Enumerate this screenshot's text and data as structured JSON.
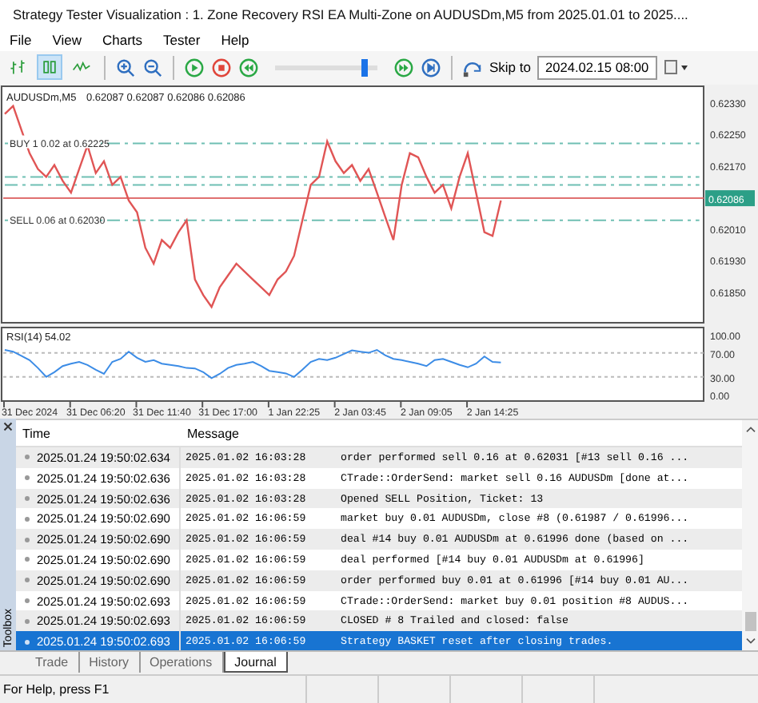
{
  "window": {
    "title": "Strategy Tester Visualization : 1. Zone Recovery RSI EA Multi-Zone on AUDUSDm,M5 from 2025.01.01 to 2025...."
  },
  "menu": [
    "File",
    "View",
    "Charts",
    "Tester",
    "Help"
  ],
  "toolbar": {
    "chart_modes": [
      {
        "kind": "bars",
        "selected": false
      },
      {
        "kind": "candles",
        "selected": true
      },
      {
        "kind": "line",
        "selected": false
      }
    ],
    "speed": {
      "level": 0.88
    },
    "skip_to_label": "Skip to",
    "skip_to_value": "2024.02.15 08:00"
  },
  "price_chart": {
    "quotes": "0.62087 0.62087 0.62086 0.62086",
    "chart_data": {
      "type": "line",
      "series": [
        {
          "name": "AUDUSDm,M5",
          "color": "#e05555",
          "values": [
            0.623,
            0.6232,
            0.6226,
            0.622,
            0.6216,
            0.6214,
            0.6217,
            0.6213,
            0.621,
            0.6216,
            0.6222,
            0.6215,
            0.6218,
            0.6212,
            0.6214,
            0.6208,
            0.6205,
            0.6196,
            0.6192,
            0.6198,
            0.6196,
            0.62,
            0.6203,
            0.6188,
            0.6184,
            0.6181,
            0.6186,
            0.6189,
            0.6192,
            0.619,
            0.6188,
            0.6186,
            0.6184,
            0.6188,
            0.619,
            0.6194,
            0.6203,
            0.6212,
            0.6214,
            0.6223,
            0.6218,
            0.6215,
            0.6217,
            0.6213,
            0.6216,
            0.621,
            0.6204,
            0.6198,
            0.6212,
            0.622,
            0.6219,
            0.6214,
            0.621,
            0.6212,
            0.6206,
            0.6214,
            0.622,
            0.621,
            0.62,
            0.6199,
            0.6208,
            null,
            null,
            null,
            null,
            null,
            null,
            null,
            null,
            null,
            null,
            null,
            null,
            null,
            null,
            null,
            null,
            null,
            null,
            null,
            null,
            null,
            null,
            null,
            null
          ]
        },
        {
          "name": "BUY 1 0.02 at 0.62225",
          "color": "#6fbfb3",
          "line_style": "dashdot",
          "values": [
            0.62225,
            0.62225,
            0.62225,
            0.62225,
            0.62225,
            0.62225,
            0.62225,
            0.62225,
            0.62225,
            0.62225,
            0.62225,
            0.62225,
            0.62225,
            0.62225,
            0.62225,
            0.62225,
            0.62225,
            0.62225,
            0.62225,
            0.62225,
            0.62225,
            0.62225,
            0.62225,
            0.62225,
            0.62225,
            0.62225,
            0.62225,
            0.62225,
            0.62225,
            0.62225,
            0.62225,
            0.62225,
            0.62225,
            0.62225,
            0.62225,
            0.62225,
            0.62225,
            0.62225,
            0.62225,
            0.62225,
            0.62225,
            0.62225,
            0.62225,
            0.62225,
            0.62225,
            0.62225,
            0.62225,
            0.62225,
            0.62225,
            0.62225,
            0.62225,
            0.62225,
            0.62225,
            0.62225,
            0.62225,
            0.62225,
            0.62225,
            0.62225,
            0.62225,
            0.62225,
            0.62225,
            0.62225,
            0.62225,
            0.62225,
            0.62225,
            0.62225,
            0.62225,
            0.62225,
            0.62225,
            0.62225,
            0.62225,
            0.62225,
            0.62225,
            0.62225,
            0.62225,
            0.62225,
            0.62225,
            0.62225,
            0.62225,
            0.62225,
            0.62225,
            0.62225,
            0.62225,
            0.62225,
            0.62225
          ]
        },
        {
          "color": "#6fbfb3",
          "line_style": "dashdot",
          "values": [
            0.6214,
            0.6214,
            0.6214,
            0.6214,
            0.6214,
            0.6214,
            0.6214,
            0.6214,
            0.6214,
            0.6214,
            0.6214,
            0.6214,
            0.6214,
            0.6214,
            0.6214,
            0.6214,
            0.6214,
            0.6214,
            0.6214,
            0.6214,
            0.6214,
            0.6214,
            0.6214,
            0.6214,
            0.6214,
            0.6214,
            0.6214,
            0.6214,
            0.6214,
            0.6214,
            0.6214,
            0.6214,
            0.6214,
            0.6214,
            0.6214,
            0.6214,
            0.6214,
            0.6214,
            0.6214,
            0.6214,
            0.6214,
            0.6214,
            0.6214,
            0.6214,
            0.6214,
            0.6214,
            0.6214,
            0.6214,
            0.6214,
            0.6214,
            0.6214,
            0.6214,
            0.6214,
            0.6214,
            0.6214,
            0.6214,
            0.6214,
            0.6214,
            0.6214,
            0.6214,
            0.6214,
            0.6214,
            0.6214,
            0.6214,
            0.6214,
            0.6214,
            0.6214,
            0.6214,
            0.6214,
            0.6214,
            0.6214,
            0.6214,
            0.6214,
            0.6214,
            0.6214,
            0.6214,
            0.6214,
            0.6214,
            0.6214,
            0.6214,
            0.6214,
            0.6214,
            0.6214,
            0.6214,
            0.6214
          ]
        },
        {
          "color": "#6fbfb3",
          "line_style": "dashdot",
          "values": [
            0.6212,
            0.6212,
            0.6212,
            0.6212,
            0.6212,
            0.6212,
            0.6212,
            0.6212,
            0.6212,
            0.6212,
            0.6212,
            0.6212,
            0.6212,
            0.6212,
            0.6212,
            0.6212,
            0.6212,
            0.6212,
            0.6212,
            0.6212,
            0.6212,
            0.6212,
            0.6212,
            0.6212,
            0.6212,
            0.6212,
            0.6212,
            0.6212,
            0.6212,
            0.6212,
            0.6212,
            0.6212,
            0.6212,
            0.6212,
            0.6212,
            0.6212,
            0.6212,
            0.6212,
            0.6212,
            0.6212,
            0.6212,
            0.6212,
            0.6212,
            0.6212,
            0.6212,
            0.6212,
            0.6212,
            0.6212,
            0.6212,
            0.6212,
            0.6212,
            0.6212,
            0.6212,
            0.6212,
            0.6212,
            0.6212,
            0.6212,
            0.6212,
            0.6212,
            0.6212,
            0.6212,
            0.6212,
            0.6212,
            0.6212,
            0.6212,
            0.6212,
            0.6212,
            0.6212,
            0.6212,
            0.6212,
            0.6212,
            0.6212,
            0.6212,
            0.6212,
            0.6212,
            0.6212,
            0.6212,
            0.6212,
            0.6212,
            0.6212,
            0.6212,
            0.6212,
            0.6212,
            0.6212,
            0.6212
          ]
        },
        {
          "name": "SELL 0.06 at 0.62030",
          "color": "#6fbfb3",
          "line_style": "dashdot",
          "values": [
            0.6203,
            0.6203,
            0.6203,
            0.6203,
            0.6203,
            0.6203,
            0.6203,
            0.6203,
            0.6203,
            0.6203,
            0.6203,
            0.6203,
            0.6203,
            0.6203,
            0.6203,
            0.6203,
            0.6203,
            0.6203,
            0.6203,
            0.6203,
            0.6203,
            0.6203,
            0.6203,
            0.6203,
            0.6203,
            0.6203,
            0.6203,
            0.6203,
            0.6203,
            0.6203,
            0.6203,
            0.6203,
            0.6203,
            0.6203,
            0.6203,
            0.6203,
            0.6203,
            0.6203,
            0.6203,
            0.6203,
            0.6203,
            0.6203,
            0.6203,
            0.6203,
            0.6203,
            0.6203,
            0.6203,
            0.6203,
            0.6203,
            0.6203,
            0.6203,
            0.6203,
            0.6203,
            0.6203,
            0.6203,
            0.6203,
            0.6203,
            0.6203,
            0.6203,
            0.6203,
            0.6203,
            0.6203,
            0.6203,
            0.6203,
            0.6203,
            0.6203,
            0.6203,
            0.6203,
            0.6203,
            0.6203,
            0.6203,
            0.6203,
            0.6203,
            0.6203,
            0.6203,
            0.6203,
            0.6203,
            0.6203,
            0.6203,
            0.6203,
            0.6203,
            0.6203,
            0.6203,
            0.6203,
            0.6203
          ]
        }
      ],
      "ylim": [
        0.6177,
        0.6237
      ],
      "ref_lines": [
        {
          "axis": "y",
          "value": 0.62086,
          "label": "0.62086",
          "color": "#e07070"
        }
      ],
      "yticks": [
        {
          "value": 0.6233,
          "label": "0.62330"
        },
        {
          "value": 0.6225,
          "label": "0.62250"
        },
        {
          "value": 0.6217,
          "label": "0.62170"
        },
        {
          "value": 0.6201,
          "label": "0.62010"
        },
        {
          "value": 0.6193,
          "label": "0.61930"
        },
        {
          "value": 0.6185,
          "label": "0.61850"
        }
      ]
    }
  },
  "rsi_chart": {
    "value": "54.02",
    "chart_data": {
      "type": "line",
      "categories": [
        null,
        null,
        null,
        "31 Dec 2024",
        null,
        null,
        null,
        null,
        null,
        null,
        null,
        "31 Dec 06:20",
        null,
        null,
        null,
        null,
        null,
        null,
        null,
        "31 Dec 11:40",
        null,
        null,
        null,
        null,
        null,
        null,
        null,
        "31 Dec 17:00",
        null,
        null,
        null,
        null,
        null,
        null,
        null,
        "1 Jan 22:25",
        null,
        null,
        null,
        null,
        null,
        null,
        null,
        "2 Jan 03:45",
        null,
        null,
        null,
        null,
        null,
        null,
        null,
        "2 Jan 09:05",
        null,
        null,
        null,
        null,
        null,
        null,
        null,
        "2 Jan 14:25",
        null,
        null,
        null,
        null,
        null,
        null,
        null,
        null,
        null,
        null,
        null,
        null,
        null,
        null,
        null,
        null,
        null,
        null,
        null,
        null,
        null,
        null,
        null,
        null,
        null
      ],
      "series": [
        {
          "name": "RSI(14)",
          "color": "#3c8ce6",
          "values": [
            75,
            72,
            65,
            58,
            45,
            30,
            38,
            48,
            52,
            55,
            50,
            42,
            35,
            55,
            60,
            72,
            62,
            55,
            58,
            52,
            50,
            48,
            45,
            44,
            38,
            28,
            35,
            45,
            50,
            52,
            55,
            48,
            40,
            38,
            36,
            30,
            42,
            55,
            60,
            58,
            62,
            68,
            74,
            72,
            70,
            75,
            66,
            60,
            58,
            55,
            52,
            48,
            58,
            60,
            55,
            50,
            46,
            52,
            64,
            55,
            54,
            null,
            null,
            null,
            null,
            null,
            null,
            null,
            null,
            null,
            null,
            null,
            null,
            null,
            null,
            null,
            null,
            null,
            null,
            null,
            null,
            null,
            null,
            null,
            null
          ]
        }
      ],
      "ylim": [
        -10,
        112
      ],
      "yticks": [
        {
          "value": 100,
          "label": "100.00"
        },
        {
          "value": 70,
          "label": "70.00"
        },
        {
          "value": 30,
          "label": "30.00"
        },
        {
          "value": 0,
          "label": "0.00"
        }
      ]
    }
  },
  "toolbox": {
    "label": "Toolbox",
    "columns": [
      "Time",
      "Message"
    ],
    "rows": [
      {
        "time": "2025.01.24 19:50:02.634",
        "date": "2025.01.02 16:03:28",
        "message": "order performed sell 0.16 at 0.62031 [#13 sell 0.16 ...",
        "selected": false
      },
      {
        "time": "2025.01.24 19:50:02.636",
        "date": "2025.01.02 16:03:28",
        "message": "CTrade::OrderSend: market sell 0.16 AUDUSDm [done at...",
        "selected": false
      },
      {
        "time": "2025.01.24 19:50:02.636",
        "date": "2025.01.02 16:03:28",
        "message": "Opened SELL Position, Ticket: 13",
        "selected": false
      },
      {
        "time": "2025.01.24 19:50:02.690",
        "date": "2025.01.02 16:06:59",
        "message": "market buy 0.01 AUDUSDm, close #8 (0.61987 / 0.61996...",
        "selected": false
      },
      {
        "time": "2025.01.24 19:50:02.690",
        "date": "2025.01.02 16:06:59",
        "message": "deal #14 buy 0.01 AUDUSDm at 0.61996 done (based on ...",
        "selected": false
      },
      {
        "time": "2025.01.24 19:50:02.690",
        "date": "2025.01.02 16:06:59",
        "message": "deal performed [#14 buy 0.01 AUDUSDm at 0.61996]",
        "selected": false
      },
      {
        "time": "2025.01.24 19:50:02.690",
        "date": "2025.01.02 16:06:59",
        "message": "order performed buy 0.01 at 0.61996 [#14 buy 0.01 AU...",
        "selected": false
      },
      {
        "time": "2025.01.24 19:50:02.693",
        "date": "2025.01.02 16:06:59",
        "message": "CTrade::OrderSend: market buy 0.01 position #8 AUDUS...",
        "selected": false
      },
      {
        "time": "2025.01.24 19:50:02.693",
        "date": "2025.01.02 16:06:59",
        "message": "CLOSED # 8 Trailed and closed: false",
        "selected": false
      },
      {
        "time": "2025.01.24 19:50:02.693",
        "date": "2025.01.02 16:06:59",
        "message": "Strategy BASKET reset after closing trades.",
        "selected": true
      }
    ],
    "tabs": [
      {
        "label": "Trade",
        "selected": false
      },
      {
        "label": "History",
        "selected": false
      },
      {
        "label": "Operations",
        "selected": false
      },
      {
        "label": "Journal",
        "selected": true
      }
    ]
  },
  "status_bar": {
    "text": "For Help, press F1"
  }
}
